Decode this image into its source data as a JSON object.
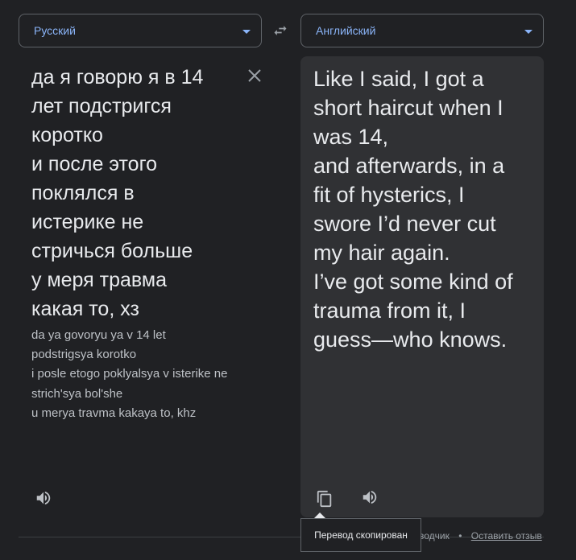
{
  "source_lang": {
    "label": "Русский",
    "icon": "chevron-down-icon"
  },
  "target_lang": {
    "label": "Английский",
    "icon": "chevron-down-icon"
  },
  "swap": {
    "icon": "swap-icon"
  },
  "source": {
    "text": "да я говорю я в 14\nлет подстригся\nкоротко\nи после этого\nпоклялся в\nистерике не\nстричься больше\nу меря травма\nкакая то, хз",
    "transliteration": "da ya govoryu ya v 14 let\npodstrigsya korotko\ni posle etogo poklyalsya v isterike ne\nstrich'sya bol'she\nu merya travma kakaya to, khz"
  },
  "target": {
    "text": "Like I said, I got a\nshort haircut when I\nwas 14,\nand afterwards, in a\nfit of hysterics, I\nswore I’d never cut\nmy hair again.\nI’ve got some kind of\ntrauma from it, I\nguess—who knows."
  },
  "tooltip": {
    "text": "Перевод скопирован"
  },
  "footer": {
    "partial": "водчик",
    "separator": "•",
    "feedback": "Оставить отзыв"
  },
  "colors": {
    "background": "#202124",
    "panel": "#303134",
    "accent": "#8ab4f8",
    "text": "#e8eaed"
  }
}
